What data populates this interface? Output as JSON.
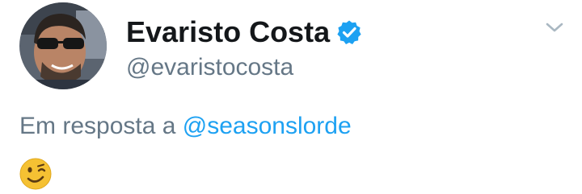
{
  "tweet": {
    "author": {
      "display_name": "Evaristo Costa",
      "handle": "@evaristocosta",
      "verified": true,
      "avatar_icon": "avatar-photo"
    },
    "reply_context": {
      "prefix": "Em resposta a",
      "mention": "@seasonslorde"
    },
    "body_emoji": "winking-face-emoji",
    "menu_icon": "chevron-down-icon"
  },
  "colors": {
    "name_text": "#14171a",
    "secondary_text": "#657786",
    "link": "#1da1f2",
    "verified_badge": "#1da1f2",
    "caret": "#aab8c2",
    "background": "#ffffff"
  }
}
